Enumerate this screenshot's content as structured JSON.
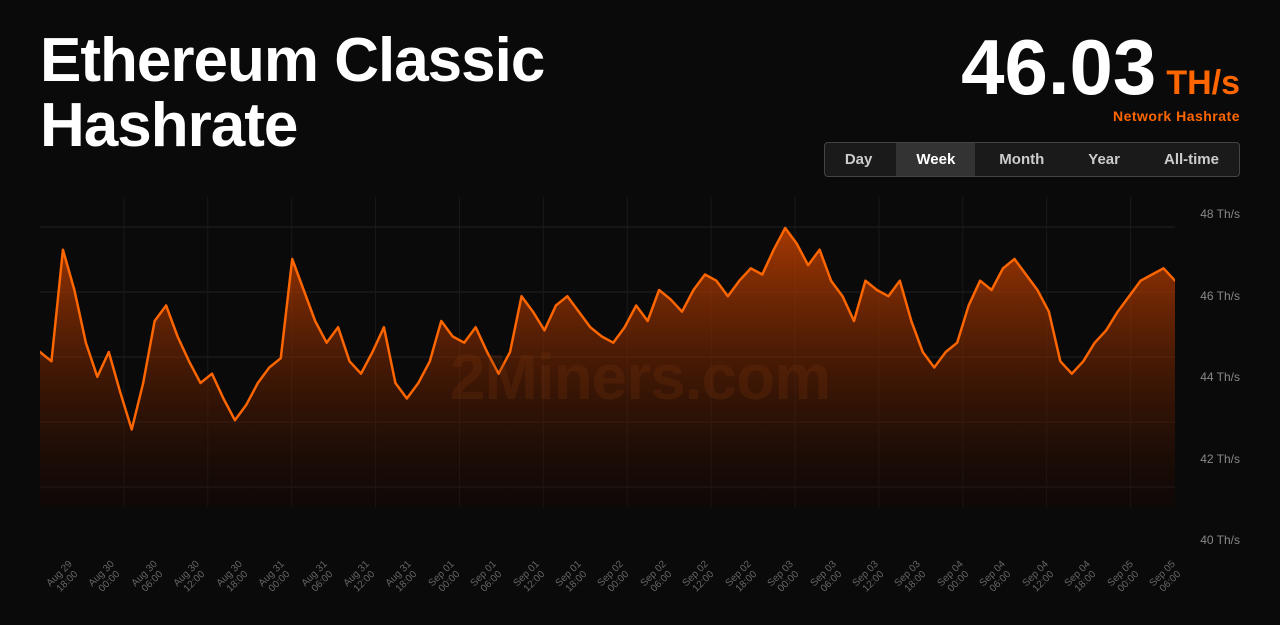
{
  "header": {
    "title_line1": "Ethereum Classic",
    "title_line2": "Hashrate",
    "hashrate_value": "46.03",
    "hashrate_unit": "TH/s",
    "hashrate_label": "Network Hashrate"
  },
  "tabs": [
    {
      "label": "Day",
      "active": false
    },
    {
      "label": "Week",
      "active": true
    },
    {
      "label": "Month",
      "active": false
    },
    {
      "label": "Year",
      "active": false
    },
    {
      "label": "All-time",
      "active": false
    }
  ],
  "watermark": "2Miners.com",
  "y_axis": {
    "labels": [
      "48 Th/s",
      "46 Th/s",
      "44 Th/s",
      "42 Th/s",
      "40 Th/s"
    ]
  },
  "x_axis": {
    "labels": [
      "Aug 29, 18:00",
      "Aug 30, 00:00",
      "Aug 30, 06:00",
      "Aug 30, 12:00",
      "Aug 30, 18:00",
      "Aug 31, 00:00",
      "Aug 31, 06:00",
      "Aug 31, 12:00",
      "Aug 31, 18:00",
      "Sep 01, 00:00",
      "Sep 01, 06:00",
      "Sep 01, 12:00",
      "Sep 01, 18:00",
      "Sep 02, 00:00",
      "Sep 02, 06:00",
      "Sep 02, 12:00",
      "Sep 02, 18:00",
      "Sep 03, 00:00",
      "Sep 03, 06:00",
      "Sep 03, 12:00",
      "Sep 03, 18:00",
      "Sep 04, 00:00",
      "Sep 04, 06:00",
      "Sep 04, 12:00",
      "Sep 04, 18:00",
      "Sep 05, 00:00",
      "Sep 05, 06:00"
    ]
  },
  "chart": {
    "min": 39.5,
    "max": 49.5,
    "data": [
      44.5,
      44.2,
      47.8,
      46.5,
      44.8,
      43.7,
      44.5,
      43.2,
      42.0,
      43.5,
      45.5,
      46.0,
      45.0,
      44.2,
      43.5,
      43.8,
      43.0,
      42.3,
      42.8,
      43.5,
      44.0,
      44.3,
      47.5,
      46.5,
      45.5,
      44.8,
      45.3,
      44.2,
      43.8,
      44.5,
      45.3,
      43.5,
      43.0,
      43.5,
      44.2,
      45.5,
      45.0,
      44.8,
      45.3,
      44.5,
      43.8,
      44.5,
      46.3,
      45.8,
      45.2,
      46.0,
      46.3,
      45.8,
      45.3,
      45.0,
      44.8,
      45.3,
      46.0,
      45.5,
      46.5,
      46.2,
      45.8,
      46.5,
      47.0,
      46.8,
      46.3,
      46.8,
      47.2,
      47.0,
      47.8,
      48.5,
      48.0,
      47.3,
      47.8,
      46.8,
      46.3,
      45.5,
      46.8,
      46.5,
      46.3,
      46.8,
      45.5,
      44.5,
      44.0,
      44.5,
      44.8,
      46.0,
      46.8,
      46.5,
      47.2,
      47.5,
      47.0,
      46.5,
      45.8,
      44.2,
      43.8,
      44.2,
      44.8,
      45.2,
      45.8,
      46.3,
      46.8,
      47.0,
      47.2,
      46.8
    ]
  },
  "colors": {
    "background": "#0a0a0a",
    "line": "#ff6600",
    "fill_top": "#cc4400",
    "fill_bottom": "#1a0500",
    "grid": "#222222",
    "accent": "#ff6600"
  }
}
